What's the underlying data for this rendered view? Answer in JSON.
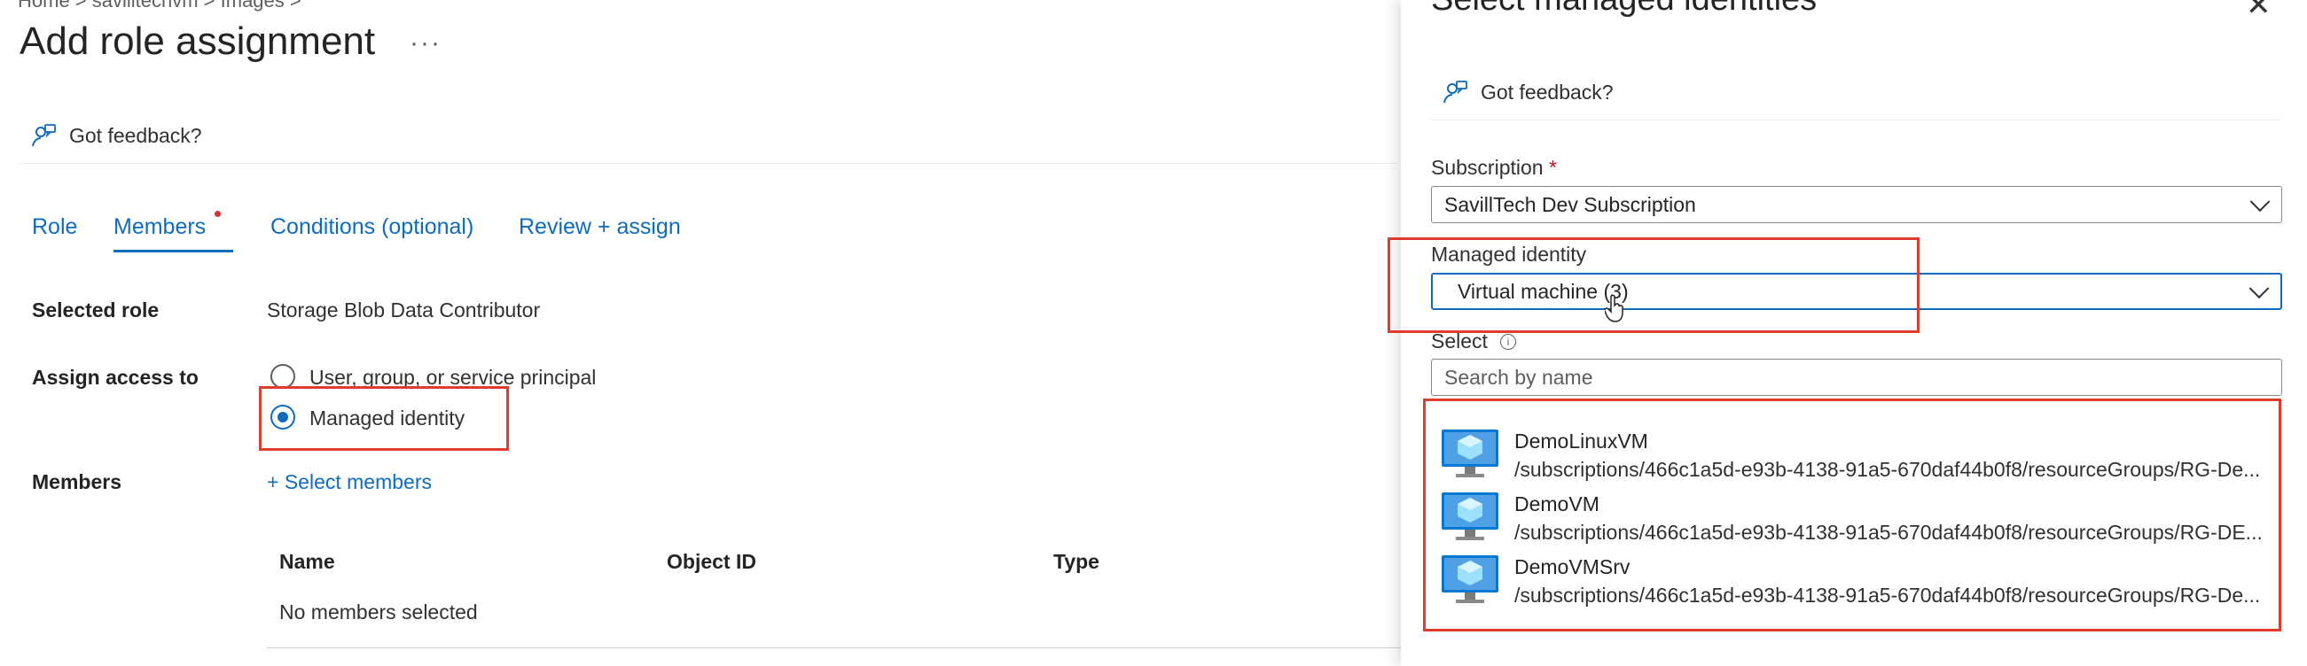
{
  "breadcrumb": "Home > savilltechvm > Images >",
  "page": {
    "title": "Add role assignment",
    "more_label": "···"
  },
  "feedback": {
    "label": "Got feedback?"
  },
  "tabs": [
    {
      "label": "Role"
    },
    {
      "label": "Members"
    },
    {
      "label": "Conditions (optional)"
    },
    {
      "label": "Review + assign"
    }
  ],
  "form": {
    "selected_role_label": "Selected role",
    "selected_role_value": "Storage Blob Data Contributor",
    "assign_access_label": "Assign access to",
    "option_user": "User, group, or service principal",
    "option_managed": "Managed identity",
    "members_label": "Members",
    "select_members_label": "+ Select members"
  },
  "members_table": {
    "headers": [
      "Name",
      "Object ID",
      "Type"
    ],
    "empty_text": "No members selected"
  },
  "panel": {
    "title": "Select managed identities",
    "close_label": "✕",
    "feedback_label": "Got feedback?",
    "subscription_label": "Subscription",
    "required_mark": "*",
    "subscription_value": "SavillTech Dev Subscription",
    "managed_identity_label": "Managed identity",
    "managed_identity_value": "Virtual machine (3)",
    "select_label": "Select",
    "search_placeholder": "Search by name",
    "items": [
      {
        "name": "DemoLinuxVM",
        "path": "/subscriptions/466c1a5d-e93b-4138-91a5-670daf44b0f8/resourceGroups/RG-De..."
      },
      {
        "name": "DemoVM",
        "path": "/subscriptions/466c1a5d-e93b-4138-91a5-670daf44b0f8/resourceGroups/RG-DE..."
      },
      {
        "name": "DemoVMSrv",
        "path": "/subscriptions/466c1a5d-e93b-4138-91a5-670daf44b0f8/resourceGroups/RG-De..."
      }
    ]
  },
  "colors": {
    "accent": "#0f6cbd",
    "highlight_box": "#e03c2c",
    "required": "#d13438"
  },
  "icons": [
    "feedback-icon",
    "vm-icon",
    "chevron-down-icon",
    "close-icon",
    "info-icon",
    "cursor-icon"
  ]
}
